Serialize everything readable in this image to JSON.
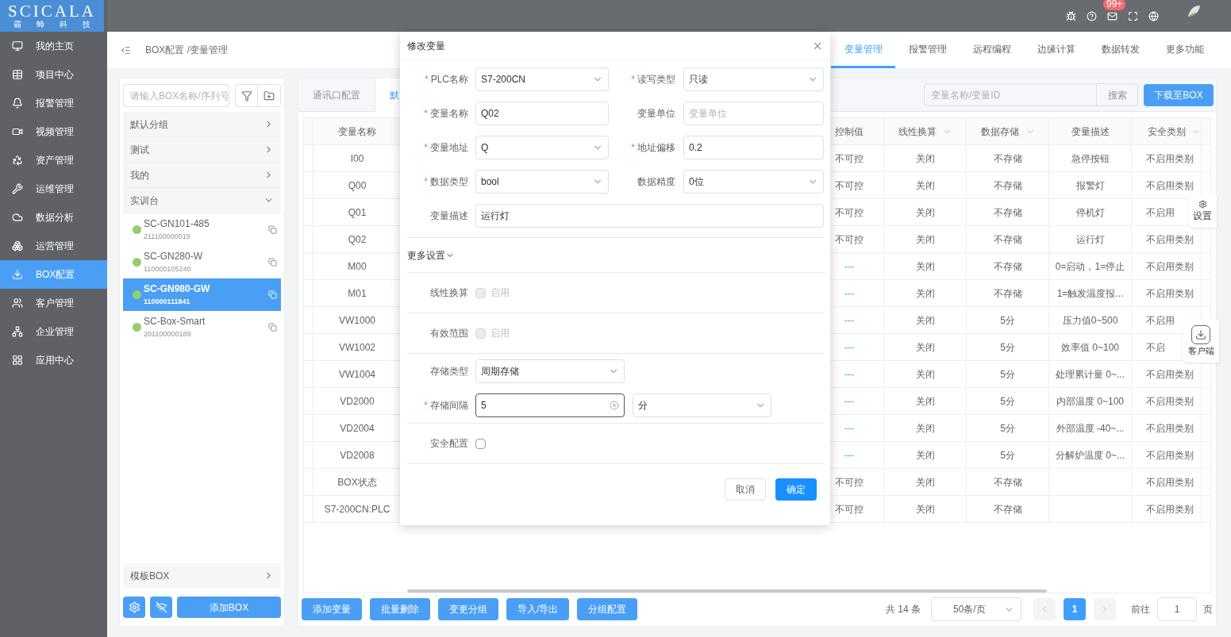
{
  "logo": {
    "title": "SCICALA",
    "subtitle": "霸 蝉 科 技"
  },
  "header": {
    "badge": "99+"
  },
  "sidebar": {
    "items": [
      {
        "label": "我的主页",
        "selected": false
      },
      {
        "label": "项目中心",
        "selected": false
      },
      {
        "label": "报警管理",
        "selected": false
      },
      {
        "label": "视频管理",
        "selected": false
      },
      {
        "label": "资产管理",
        "selected": false
      },
      {
        "label": "运维管理",
        "selected": false
      },
      {
        "label": "数据分析",
        "selected": false
      },
      {
        "label": "运营管理",
        "selected": false
      },
      {
        "label": "BOX配置",
        "selected": true
      },
      {
        "label": "客户管理",
        "selected": false
      },
      {
        "label": "企业管理",
        "selected": false
      },
      {
        "label": "应用中心",
        "selected": false
      }
    ]
  },
  "breadcrumb": "BOX配置 /变量管理",
  "top_tabs": [
    {
      "label": "变量管理",
      "selected": true
    },
    {
      "label": "报警管理",
      "selected": false
    },
    {
      "label": "远程编程",
      "selected": false
    },
    {
      "label": "边缘计算",
      "selected": false
    },
    {
      "label": "数据转发",
      "selected": false
    },
    {
      "label": "更多功能",
      "selected": false
    }
  ],
  "box_panel": {
    "search": {
      "placeholder": "请输入BOX名称/序列号"
    },
    "groups": [
      {
        "label": "默认分组",
        "expanded": false
      },
      {
        "label": "测试",
        "expanded": false
      },
      {
        "label": "我的",
        "expanded": false
      },
      {
        "label": "实训台",
        "expanded": true,
        "children": [
          {
            "name": "SC-GN101-485",
            "serial": "211100000019",
            "online": true,
            "selected": false
          },
          {
            "name": "SC-GN280-W",
            "serial": "110000105240",
            "online": true,
            "selected": false
          },
          {
            "name": "SC-GN980-GW",
            "serial": "110000111841",
            "online": true,
            "selected": true
          },
          {
            "name": "SC-Box-Smart",
            "serial": "201100000189",
            "online": true,
            "selected": false
          }
        ]
      }
    ],
    "template_group": {
      "label": "模板BOX",
      "expanded": false
    },
    "add_button": "添加BOX"
  },
  "sub_tabs": [
    {
      "label": "通讯口配置",
      "selected": false
    },
    {
      "label": "默",
      "selected": true
    }
  ],
  "search": {
    "placeholder": "变量名称/变量ID",
    "button": "搜索"
  },
  "download_button": "下载至BOX",
  "table": {
    "columns": [
      {
        "label": "变量名称",
        "filter": false
      },
      {
        "label": "控制值",
        "filter": false
      },
      {
        "label": "线性换算",
        "filter": true
      },
      {
        "label": "数据存储",
        "filter": true
      },
      {
        "label": "变量描述",
        "filter": false
      },
      {
        "label": "安全类别",
        "filter": true
      }
    ],
    "rows": [
      {
        "name": "I00",
        "control": {
          "text": "不可控",
          "link": false
        },
        "linear": "关闭",
        "storage": "不存储",
        "description": "急停按钮",
        "safety": "不启用类别"
      },
      {
        "name": "Q00",
        "control": {
          "text": "不可控",
          "link": false
        },
        "linear": "关闭",
        "storage": "不存储",
        "description": "报警灯",
        "safety": "不启用类别"
      },
      {
        "name": "Q01",
        "control": {
          "text": "不可控",
          "link": false
        },
        "linear": "关闭",
        "storage": "不存储",
        "description": "停机灯",
        "safety": "不启用"
      },
      {
        "name": "Q02",
        "control": {
          "text": "不可控",
          "link": false
        },
        "linear": "关闭",
        "storage": "不存储",
        "description": "运行灯",
        "safety": "不启用类别"
      },
      {
        "name": "M00",
        "control": {
          "text": "---",
          "link": true
        },
        "linear": "关闭",
        "storage": "不存储",
        "description": "0=启动，1=停止",
        "safety": "不启用类别"
      },
      {
        "name": "M01",
        "control": {
          "text": "---",
          "link": true
        },
        "linear": "关闭",
        "storage": "不存储",
        "description": "1=触发温度报...",
        "safety": "不启用类别"
      },
      {
        "name": "VW1000",
        "control": {
          "text": "---",
          "link": true
        },
        "linear": "关闭",
        "storage": "5分",
        "description": "压力值0~500",
        "safety": "不启用"
      },
      {
        "name": "VW1002",
        "control": {
          "text": "---",
          "link": true
        },
        "linear": "关闭",
        "storage": "5分",
        "description": "效率值 0~100",
        "safety": "不启"
      },
      {
        "name": "VW1004",
        "control": {
          "text": "---",
          "link": true
        },
        "linear": "关闭",
        "storage": "5分",
        "description": "处理累计量 0~...",
        "safety": "不启用类别"
      },
      {
        "name": "VD2000",
        "control": {
          "text": "---",
          "link": true
        },
        "linear": "关闭",
        "storage": "5分",
        "description": "内部温度 0~100",
        "safety": "不启用类别"
      },
      {
        "name": "VD2004",
        "control": {
          "text": "---",
          "link": true
        },
        "linear": "关闭",
        "storage": "5分",
        "description": "外部温度 -40~...",
        "safety": "不启用类别"
      },
      {
        "name": "VD2008",
        "control": {
          "text": "---",
          "link": true
        },
        "linear": "关闭",
        "storage": "5分",
        "description": "分解炉温度 0~...",
        "safety": "不启用类别"
      },
      {
        "name": "BOX状态",
        "control": {
          "text": "不可控",
          "link": false
        },
        "linear": "关闭",
        "storage": "不存储",
        "safety": "不启用类别"
      },
      {
        "name": "S7-200CN:PLC",
        "control": {
          "text": "不可控",
          "link": false
        },
        "linear": "关闭",
        "storage": "不存储",
        "safety": "不启用类别"
      }
    ]
  },
  "bottom_buttons": [
    "添加变量",
    "批量删除",
    "变更分组",
    "导入/导出",
    "分组配置"
  ],
  "pagination": {
    "total": "共 14 条",
    "page_size": "50条/页",
    "pages": [
      {
        "label": "1",
        "selected": true
      }
    ],
    "goto_label": "前往",
    "goto_value": "1",
    "goto_suffix": "页"
  },
  "floating": [
    "设置",
    "客户端"
  ],
  "modal": {
    "title": "修改变量",
    "required_mark": "*",
    "rows": [
      [
        {
          "label": "PLC名称",
          "required": true,
          "kind": "select",
          "value": "S7-200CN"
        },
        {
          "label": "读写类型",
          "required": true,
          "kind": "select",
          "value": "只读"
        }
      ],
      [
        {
          "label": "变量名称",
          "required": true,
          "kind": "input",
          "value": "Q02"
        },
        {
          "label": "变量单位",
          "required": false,
          "kind": "input",
          "placeholder": "变量单位"
        }
      ],
      [
        {
          "label": "变量地址",
          "required": true,
          "kind": "select",
          "value": "Q"
        },
        {
          "label": "地址偏移",
          "required": true,
          "kind": "input",
          "value": "0.2"
        }
      ],
      [
        {
          "label": "数据类型",
          "required": true,
          "kind": "select",
          "value": "bool"
        },
        {
          "label": "数据精度",
          "required": false,
          "kind": "select",
          "value": "0位"
        }
      ],
      [
        {
          "label": "变量描述",
          "required": false,
          "kind": "input",
          "value": "运行灯"
        }
      ]
    ],
    "more_settings": {
      "label": "更多设置",
      "expanded": true
    },
    "sections": [
      {
        "label": "线性换算",
        "required": false,
        "kind": "checkbox",
        "checked": false,
        "disabled": true,
        "text": "启用"
      },
      {
        "label": "有效范围",
        "required": false,
        "kind": "checkbox",
        "checked": false,
        "disabled": true,
        "text": "启用"
      },
      {
        "label": "存储类型",
        "required": false,
        "kind": "select",
        "value": "周期存储"
      },
      {
        "label": "存储间隔",
        "required": true,
        "kind": "interval",
        "value": "5",
        "unit": "分",
        "focused": true
      },
      {
        "label": "安全配置",
        "required": false,
        "kind": "checkbox",
        "checked": false,
        "disabled": false
      }
    ],
    "cancel": "取消",
    "confirm": "确定"
  }
}
